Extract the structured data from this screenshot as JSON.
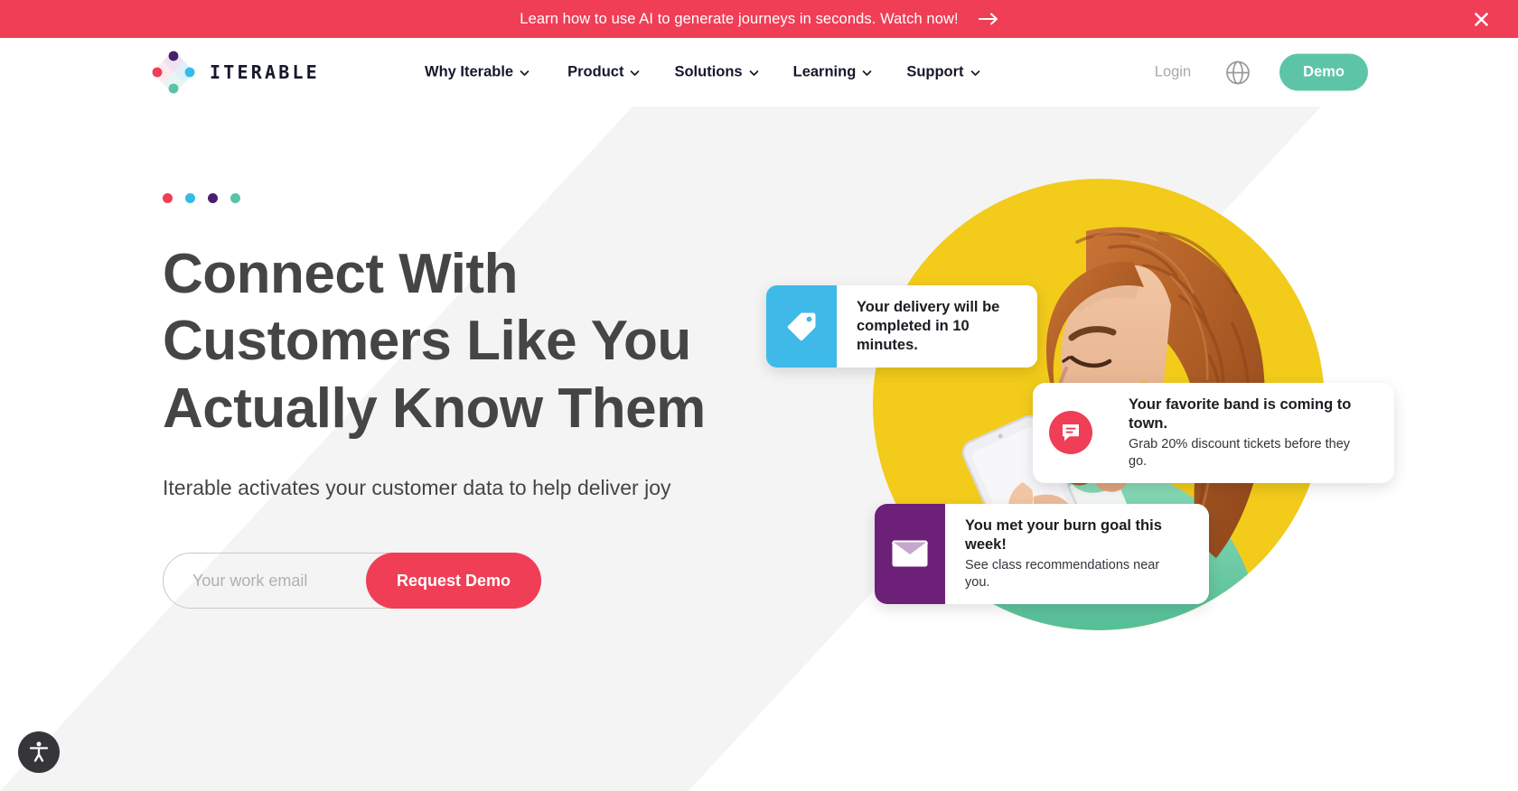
{
  "banner": {
    "text": "Learn how to use AI to generate journeys in seconds. Watch now!",
    "arrow_icon": "arrow-right-icon",
    "close_icon": "close-icon",
    "background_color": "#ef3e56"
  },
  "header": {
    "logo": {
      "wordmark": "ITERABLE",
      "mark_icon": "iterable-diamond-logo-icon",
      "mark_colors": {
        "top": "#4b1e6d",
        "left": "#ef3e56",
        "right": "#34bbe6",
        "bottom": "#5bc2a7"
      }
    },
    "nav": [
      {
        "label": "Why Iterable",
        "chevron_icon": "chevron-down-icon"
      },
      {
        "label": "Product",
        "chevron_icon": "chevron-down-icon"
      },
      {
        "label": "Solutions",
        "chevron_icon": "chevron-down-icon"
      },
      {
        "label": "Learning",
        "chevron_icon": "chevron-down-icon"
      },
      {
        "label": "Support",
        "chevron_icon": "chevron-down-icon"
      }
    ],
    "login_label": "Login",
    "language_icon": "globe-icon",
    "demo_label": "Demo",
    "demo_color": "#5ec4a7"
  },
  "hero": {
    "dots": [
      {
        "name": "dot-red",
        "color": "#ef3e56"
      },
      {
        "name": "dot-blue",
        "color": "#34bbe6"
      },
      {
        "name": "dot-purple",
        "color": "#4b1e6d"
      },
      {
        "name": "dot-teal",
        "color": "#5bc2a7"
      }
    ],
    "headline": "Connect With Customers Like You Actually Know Them",
    "subheadline": "Iterable activates your customer data to help deliver joy",
    "form": {
      "email_placeholder": "Your work email",
      "email_value": "",
      "submit_label": "Request Demo",
      "submit_color": "#ef3e56"
    },
    "image": {
      "alt": "Smiling woman with curly auburn hair in a mint green top looking at her phone",
      "circle_color": "#f2cb1b",
      "top_color": "#7fd2b2",
      "hair_color": "#b5622a"
    },
    "notifications": [
      {
        "id": "delivery",
        "icon": "tag-icon",
        "icon_bg": "#3fb9e8",
        "title": "Your delivery will be\ncompleted in 10 minutes.",
        "subtitle": ""
      },
      {
        "id": "band",
        "icon": "chat-bubble-icon",
        "icon_bg": "#ef3e56",
        "title": "Your favorite band is coming to town.",
        "subtitle": "Grab 20% discount tickets before they go."
      },
      {
        "id": "burn",
        "icon": "envelope-icon",
        "icon_bg": "#6d2077",
        "title": "You met your burn goal this week!",
        "subtitle": "See class recommendations near you."
      }
    ]
  },
  "accessibility": {
    "icon": "accessibility-person-icon",
    "label": "Accessibility options"
  }
}
